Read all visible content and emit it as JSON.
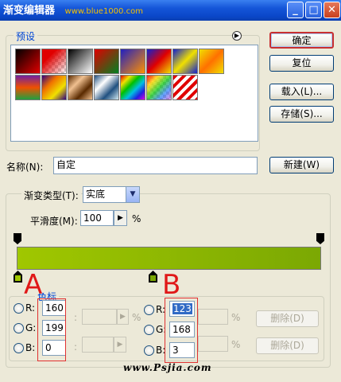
{
  "window": {
    "title": "渐变编辑器",
    "site_watermark": "www.blue1000.com"
  },
  "presets": {
    "label": "预设"
  },
  "buttons": {
    "ok": "确定",
    "reset": "复位",
    "load": "载入(L)...",
    "save": "存储(S)...",
    "new": "新建(W)",
    "delete_left": "删除(D)",
    "delete_right": "删除(D)"
  },
  "name_field": {
    "label": "名称(N):",
    "value": "自定"
  },
  "gradient": {
    "type_label": "渐变类型(T):",
    "type_value": "实底",
    "smoothness_label": "平滑度(M):",
    "smoothness_value": "100",
    "smoothness_unit": "%",
    "start_color": "#a0c700",
    "end_color": "#7ba803"
  },
  "color_group": {
    "label": "色标"
  },
  "left_fields": {
    "r_label": "R:",
    "r": "160",
    "g_label": "G:",
    "g": "199",
    "b_label": "B:",
    "b": "0",
    "pct1": "%"
  },
  "right_fields": {
    "r_label": "R:",
    "r": "123",
    "g_label": "G:",
    "g": "168",
    "b_label": "B:",
    "b": "3",
    "pct1": "%",
    "pct2": "%"
  },
  "annotations": {
    "a": "A",
    "b": "B"
  },
  "footer": {
    "watermark": "www.Psjia.com"
  }
}
